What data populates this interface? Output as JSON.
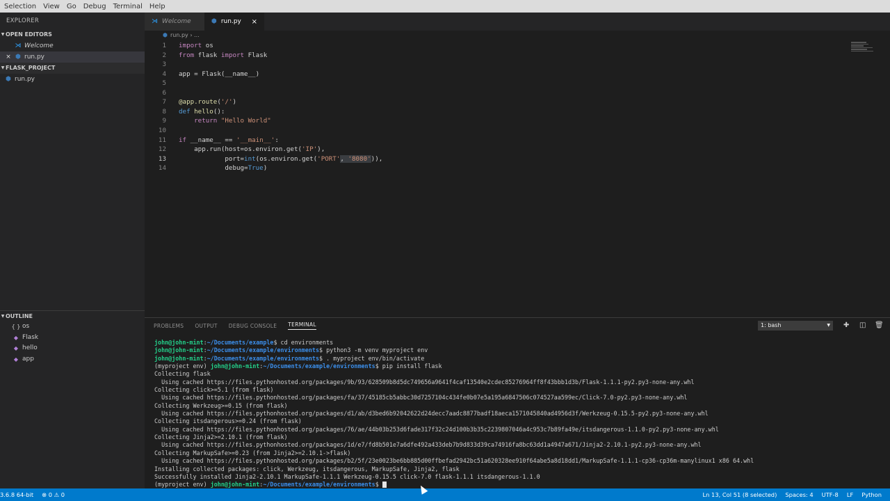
{
  "menubar": [
    "Selection",
    "View",
    "Go",
    "Debug",
    "Terminal",
    "Help"
  ],
  "sidebar": {
    "title": "EXPLORER",
    "open_editors_label": "OPEN EDITORS",
    "open_editors": [
      {
        "name": "Welcome",
        "icon": "vscode-icon"
      },
      {
        "name": "run.py",
        "icon": "python-icon",
        "close": "×"
      }
    ],
    "project_label": "FLASK_PROJECT",
    "project_files": [
      {
        "name": "run.py"
      }
    ],
    "outline_label": "OUTLINE",
    "outline": [
      {
        "name": "os",
        "glyph": "{ }"
      },
      {
        "name": "Flask",
        "glyph": "◆"
      },
      {
        "name": "hello",
        "glyph": "◆"
      },
      {
        "name": "app",
        "glyph": "◆"
      }
    ]
  },
  "tabs": [
    {
      "label": "Welcome",
      "active": false
    },
    {
      "label": "run.py",
      "active": true,
      "close": "×"
    }
  ],
  "breadcrumb": "run.py › ...",
  "editor": {
    "current_line": 13,
    "lines": [
      {
        "n": "1",
        "html": "<span class='kw'>import</span><span class='txt'> os</span>"
      },
      {
        "n": "2",
        "html": "<span class='kw'>from</span><span class='txt'> flask </span><span class='kw'>import</span><span class='txt'> Flask</span>"
      },
      {
        "n": "3",
        "html": ""
      },
      {
        "n": "4",
        "html": "<span class='txt'>app = Flask(__name__)</span>"
      },
      {
        "n": "5",
        "html": ""
      },
      {
        "n": "6",
        "html": ""
      },
      {
        "n": "7",
        "html": "<span class='fn'>@app.route</span><span class='txt'>(</span><span class='str'>'/'</span><span class='txt'>)</span>"
      },
      {
        "n": "8",
        "html": "<span class='kw2'>def</span><span class='fn'> hello</span><span class='txt'>():</span>"
      },
      {
        "n": "9",
        "html": "<span class='txt'>    </span><span class='kw'>return</span><span class='str'> \"Hello World\"</span>"
      },
      {
        "n": "10",
        "html": ""
      },
      {
        "n": "11",
        "html": "<span class='kw'>if</span><span class='txt'> __name__ == </span><span class='str'>'__main__'</span><span class='txt'>:</span>"
      },
      {
        "n": "12",
        "html": "<span class='txt'>    app.run(host=os.environ.get(</span><span class='str'>'IP'</span><span class='txt'>),</span>"
      },
      {
        "n": "13",
        "html": "<span class='txt'>            port=</span><span class='kw2'>int</span><span class='txt'>(os.environ.get(</span><span class='str'>'PORT'</span><span class='sel'><span class='txt'>, </span><span class='str'>'8080'</span></span><span class='txt'>)),</span>"
      },
      {
        "n": "14",
        "html": "<span class='txt'>            debug=</span><span class='kw2'>True</span><span class='txt'>)</span>"
      }
    ]
  },
  "panel": {
    "tabs": [
      "PROBLEMS",
      "OUTPUT",
      "DEBUG CONSOLE",
      "TERMINAL"
    ],
    "active_tab": "TERMINAL",
    "terminal_select": "1: bash",
    "terminal_lines": [
      [
        {
          "c": "tp",
          "t": "john@john-mint"
        },
        {
          "c": "",
          "t": ":"
        },
        {
          "c": "tpath",
          "t": "~/Documents/example"
        },
        {
          "c": "",
          "t": "$ cd environments"
        }
      ],
      [
        {
          "c": "tp",
          "t": "john@john-mint"
        },
        {
          "c": "",
          "t": ":"
        },
        {
          "c": "tpath",
          "t": "~/Documents/example/environments"
        },
        {
          "c": "",
          "t": "$ python3 -m venv myproject env"
        }
      ],
      [
        {
          "c": "tp",
          "t": "john@john-mint"
        },
        {
          "c": "",
          "t": ":"
        },
        {
          "c": "tpath",
          "t": "~/Documents/example/environments"
        },
        {
          "c": "",
          "t": "$ . myproject env/bin/activate"
        }
      ],
      [
        {
          "c": "",
          "t": "(myproject env) "
        },
        {
          "c": "tp",
          "t": "john@john-mint"
        },
        {
          "c": "",
          "t": ":"
        },
        {
          "c": "tpath",
          "t": "~/Documents/example/environments"
        },
        {
          "c": "",
          "t": "$ pip install flask"
        }
      ],
      [
        {
          "c": "",
          "t": "Collecting flask"
        }
      ],
      [
        {
          "c": "",
          "t": "  Using cached https://files.pythonhosted.org/packages/9b/93/628509b8d5dc749656a9641f4caf13540e2cdec85276964ff8f43bbb1d3b/Flask-1.1.1-py2.py3-none-any.whl"
        }
      ],
      [
        {
          "c": "",
          "t": "Collecting click>=5.1 (from flask)"
        }
      ],
      [
        {
          "c": "",
          "t": "  Using cached https://files.pythonhosted.org/packages/fa/37/45185cb5abbc30d7257104c434fe0b07e5a195a6847506c074527aa599ec/Click-7.0-py2.py3-none-any.whl"
        }
      ],
      [
        {
          "c": "",
          "t": "Collecting Werkzeug>=0.15 (from flask)"
        }
      ],
      [
        {
          "c": "",
          "t": "  Using cached https://files.pythonhosted.org/packages/d1/ab/d3bed6b92042622d24decc7aadc8877badf18aeca1571045840ad4956d3f/Werkzeug-0.15.5-py2.py3-none-any.whl"
        }
      ],
      [
        {
          "c": "",
          "t": "Collecting itsdangerous>=0.24 (from flask)"
        }
      ],
      [
        {
          "c": "",
          "t": "  Using cached https://files.pythonhosted.org/packages/76/ae/44b03b253d6fade317f32c24d100b3b35c2239807046a4c953c7b89fa49e/itsdangerous-1.1.0-py2.py3-none-any.whl"
        }
      ],
      [
        {
          "c": "",
          "t": "Collecting Jinja2>=2.10.1 (from flask)"
        }
      ],
      [
        {
          "c": "",
          "t": "  Using cached https://files.pythonhosted.org/packages/1d/e7/fd8b501e7a6dfe492a433deb7b9d833d39ca74916fa8bc63dd1a4947a671/Jinja2-2.10.1-py2.py3-none-any.whl"
        }
      ],
      [
        {
          "c": "",
          "t": "Collecting MarkupSafe>=0.23 (from Jinja2>=2.10.1->flask)"
        }
      ],
      [
        {
          "c": "",
          "t": "  Using cached https://files.pythonhosted.org/packages/b2/5f/23e0023be6bb885d00ffbefad2942bc51a620328ee910f64abe5a8d18dd1/MarkupSafe-1.1.1-cp36-cp36m-manylinux1 x86 64.whl"
        }
      ],
      [
        {
          "c": "",
          "t": "Installing collected packages: click, Werkzeug, itsdangerous, MarkupSafe, Jinja2, flask"
        }
      ],
      [
        {
          "c": "",
          "t": "Successfully installed Jinja2-2.10.1 MarkupSafe-1.1.1 Werkzeug-0.15.5 click-7.0 flask-1.1.1 itsdangerous-1.1.0"
        }
      ],
      [
        {
          "c": "",
          "t": "(myproject env) "
        },
        {
          "c": "tp",
          "t": "john@john-mint"
        },
        {
          "c": "",
          "t": ":"
        },
        {
          "c": "tpath",
          "t": "~/Documents/example/environments"
        },
        {
          "c": "",
          "t": "$ "
        },
        {
          "c": "cursor",
          "t": ""
        }
      ]
    ]
  },
  "statusbar": {
    "python_version": "3.6.8 64-bit",
    "problems": "⊗ 0 ⚠ 0",
    "position": "Ln 13, Col 51 (8 selected)",
    "spaces": "Spaces: 4",
    "encoding": "UTF-8",
    "eol": "LF",
    "language": "Python"
  },
  "colors": {
    "statusbar": "#007acc",
    "sidebar": "#252526",
    "editor": "#1e1e1e"
  }
}
